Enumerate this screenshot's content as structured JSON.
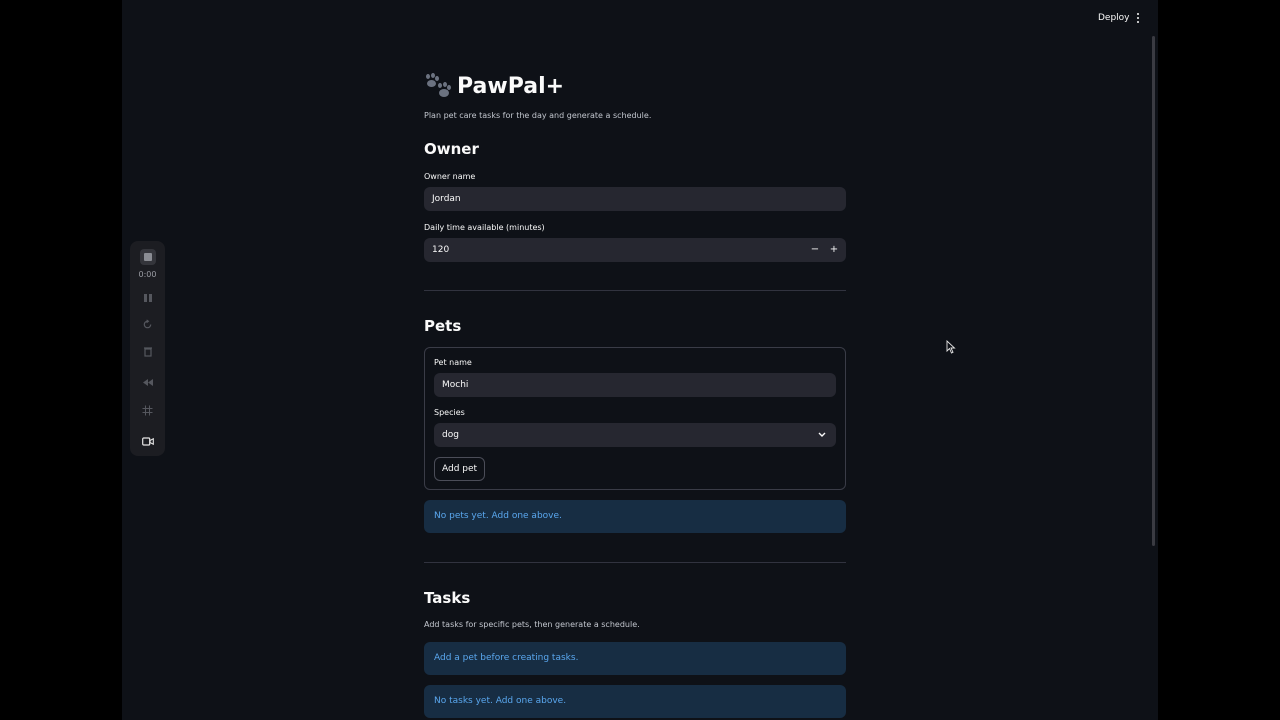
{
  "topbar": {
    "deploy_label": "Deploy",
    "menu_icon": "kebab-icon"
  },
  "app": {
    "title": "PawPal+",
    "title_icon": "paw-prints-icon",
    "subtitle": "Plan pet care tasks for the day and generate a schedule."
  },
  "owner": {
    "heading": "Owner",
    "name_label": "Owner name",
    "name_value": "Jordan",
    "time_label": "Daily time available (minutes)",
    "time_value": "120",
    "decrement": "−",
    "increment": "+"
  },
  "pets": {
    "heading": "Pets",
    "pet_name_label": "Pet name",
    "pet_name_value": "Mochi",
    "species_label": "Species",
    "species_value": "dog",
    "add_button": "Add pet",
    "empty_message": "No pets yet. Add one above."
  },
  "tasks": {
    "heading": "Tasks",
    "caption": "Add tasks for specific pets, then generate a schedule.",
    "need_pet_message": "Add a pet before creating tasks.",
    "empty_message": "No tasks yet. Add one above."
  },
  "recorder": {
    "time": "0:00",
    "controls": [
      "stop-icon",
      "pause-icon",
      "restart-icon",
      "trash-icon",
      "rewind-icon",
      "grid-icon",
      "camera-icon"
    ]
  },
  "colors": {
    "background": "#0e1117",
    "input_background": "#262730",
    "info_background": "#172d43",
    "info_text": "#5aa7ee"
  }
}
